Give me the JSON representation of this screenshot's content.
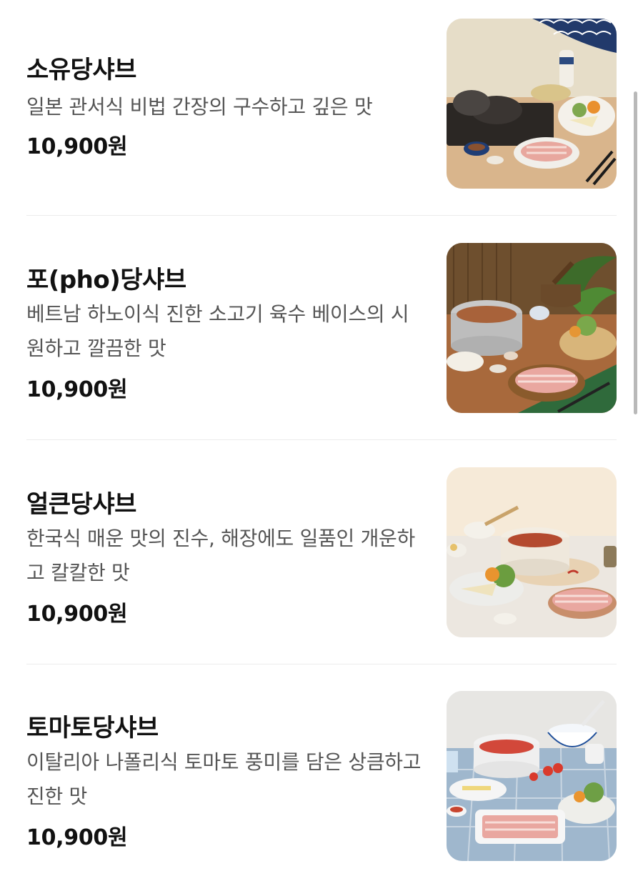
{
  "menu": {
    "items": [
      {
        "name": "소유당샤브",
        "description": "일본 관서식 비법 간장의 구수하고 깊은 맛",
        "price": "10,900원",
        "photo": "soy-shabu-photo"
      },
      {
        "name": "포(pho)당샤브",
        "description": "베트남 하노이식 진한 소고기 육수 베이스의 시원하고 깔끔한 맛",
        "price": "10,900원",
        "photo": "pho-shabu-photo"
      },
      {
        "name": "얼큰당샤브",
        "description": "한국식 매운 맛의 진수, 해장에도 일품인 개운하고 칼칼한 맛",
        "price": "10,900원",
        "photo": "spicy-shabu-photo"
      },
      {
        "name": "토마토당샤브",
        "description": "이탈리아 나폴리식 토마토 풍미를 담은 상큼하고 진한 맛",
        "price": "10,900원",
        "photo": "tomato-shabu-photo"
      }
    ]
  },
  "colors": {
    "text_primary": "#111111",
    "text_secondary": "#555555",
    "divider": "#ececec",
    "scrollbar": "#b9b9b9"
  }
}
